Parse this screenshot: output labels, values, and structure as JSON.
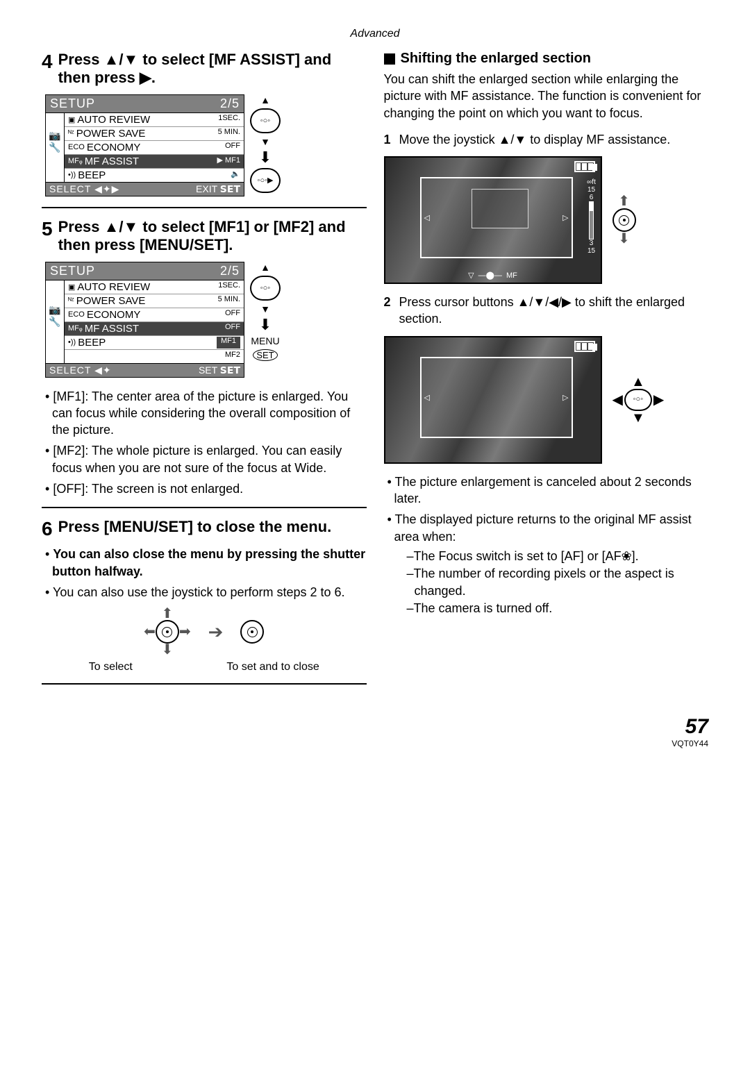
{
  "header": "Advanced",
  "left": {
    "step4": {
      "num": "4",
      "text": "Press ▲/▼ to select [MF ASSIST] and then press ▶."
    },
    "setup1": {
      "title": "SETUP",
      "page": "2/5",
      "items": [
        {
          "label": "AUTO REVIEW",
          "icon": "▣",
          "val": "1SEC."
        },
        {
          "label": "POWER SAVE",
          "icon": "ᴺᶻ",
          "val": "5 MIN."
        },
        {
          "label": "ECONOMY",
          "icon": "ECO",
          "val": "OFF"
        },
        {
          "label": "MF ASSIST",
          "icon": "MFᵩ",
          "val": "MF1",
          "sel": true,
          "marker": "▶"
        },
        {
          "label": "BEEP",
          "icon": "•))",
          "val": "🔈"
        }
      ],
      "footerLeft": "SELECT ◀✦▶",
      "footerRight": "EXIT 𝗦𝗘𝗧",
      "ctrlLabel": ""
    },
    "step5": {
      "num": "5",
      "text": "Press ▲/▼ to select [MF1] or [MF2] and then press [MENU/SET]."
    },
    "setup2": {
      "title": "SETUP",
      "page": "2/5",
      "items": [
        {
          "label": "AUTO REVIEW",
          "icon": "▣",
          "val": "1SEC."
        },
        {
          "label": "POWER SAVE",
          "icon": "ᴺᶻ",
          "val": "5 MIN."
        },
        {
          "label": "ECONOMY",
          "icon": "ECO",
          "val": "OFF"
        },
        {
          "label": "MF ASSIST",
          "icon": "MFᵩ",
          "val": "OFF",
          "sel": true
        },
        {
          "label": "BEEP",
          "icon": "•))",
          "val": "MF1",
          "valsel": true
        },
        {
          "label": "",
          "icon": "",
          "val": "MF2"
        }
      ],
      "footerLeft": "SELECT ◀✦",
      "footerMid": "SET 𝗦𝗘𝗧",
      "ctrlLabel": "MENU",
      "ctrlBtn": "SET"
    },
    "bullets_mf": [
      "[MF1]: The center area of the picture is enlarged. You can focus while considering the overall composition of the picture.",
      "[MF2]: The whole picture is enlarged. You can easily focus when you are not sure of the focus at Wide.",
      "[OFF]: The screen is not enlarged."
    ],
    "step6": {
      "num": "6",
      "text": "Press [MENU/SET] to close the menu."
    },
    "close_bullets_bold": "You can also close the menu by pressing the shutter button halfway.",
    "close_bullets_plain": "You can also use the joystick to perform steps 2 to 6.",
    "joy_labels": {
      "left": "To select",
      "right": "To set and to close"
    }
  },
  "right": {
    "heading": "Shifting the enlarged section",
    "intro": "You can shift the enlarged section while enlarging the picture with MF assistance. The function is convenient for changing the point on which you want to focus.",
    "s1": {
      "num": "1",
      "text": "Move the joystick ▲/▼ to display MF assistance."
    },
    "scale": {
      "top": "∞ft",
      "a": "15",
      "b": "6",
      "c": "3",
      "d": "15"
    },
    "mf_label": "MF",
    "s2": {
      "num": "2",
      "text": "Press cursor buttons ▲/▼/◀/▶ to shift the enlarged section."
    },
    "post_bullets": [
      "The picture enlargement is canceled about 2 seconds later.",
      "The displayed picture returns to the original MF assist area when:"
    ],
    "dashes": [
      "The Focus switch is set to [AF] or [AF❀].",
      "The number of recording pixels or the aspect is changed.",
      "The camera is turned off."
    ]
  },
  "footer": {
    "page": "57",
    "doc": "VQT0Y44"
  }
}
